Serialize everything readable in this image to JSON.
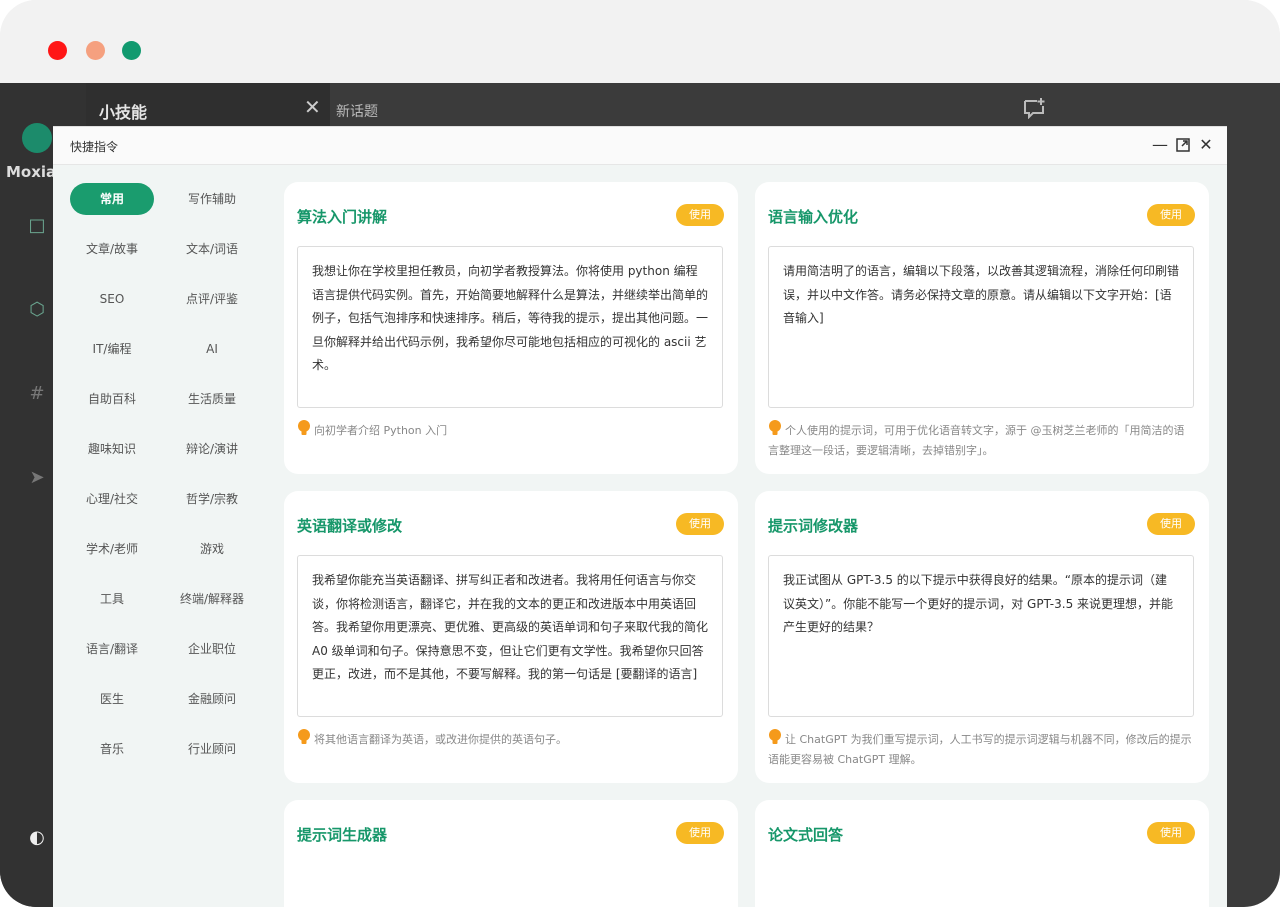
{
  "app": {
    "logo_text": "Moxia",
    "skills_title": "小技能",
    "topic_title": "新话题"
  },
  "modal": {
    "title": "快捷指令",
    "categories": [
      {
        "label": "常用",
        "active": true
      },
      {
        "label": "写作辅助"
      },
      {
        "label": "文章/故事"
      },
      {
        "label": "文本/词语"
      },
      {
        "label": "SEO"
      },
      {
        "label": "点评/评鉴"
      },
      {
        "label": "IT/编程"
      },
      {
        "label": "AI"
      },
      {
        "label": "自助百科"
      },
      {
        "label": "生活质量"
      },
      {
        "label": "趣味知识"
      },
      {
        "label": "辩论/演讲"
      },
      {
        "label": "心理/社交"
      },
      {
        "label": "哲学/宗教"
      },
      {
        "label": "学术/老师"
      },
      {
        "label": "游戏"
      },
      {
        "label": "工具"
      },
      {
        "label": "终端/解释器"
      },
      {
        "label": "语言/翻译"
      },
      {
        "label": "企业职位"
      },
      {
        "label": "医生"
      },
      {
        "label": "金融顾问"
      },
      {
        "label": "音乐"
      },
      {
        "label": "行业顾问"
      }
    ],
    "use_label": "使用",
    "cards": [
      {
        "title": "算法入门讲解",
        "prompt": "我想让你在学校里担任教员，向初学者教授算法。你将使用 python 编程语言提供代码实例。首先，开始简要地解释什么是算法，并继续举出简单的例子，包括气泡排序和快速排序。稍后，等待我的提示，提出其他问题。一旦你解释并给出代码示例，我希望你尽可能地包括相应的可视化的 ascii 艺术。",
        "desc": "向初学者介绍 Python 入门"
      },
      {
        "title": "语言输入优化",
        "prompt": "请用简洁明了的语言，编辑以下段落，以改善其逻辑流程，消除任何印刷错误，并以中文作答。请务必保持文章的原意。请从编辑以下文字开始：[语音输入]",
        "desc": "个人使用的提示词，可用于优化语音转文字，源于 @玉树芝兰老师的「用简洁的语言整理这一段话，要逻辑清晰，去掉错别字」。"
      },
      {
        "title": "英语翻译或修改",
        "prompt": "我希望你能充当英语翻译、拼写纠正者和改进者。我将用任何语言与你交谈，你将检测语言，翻译它，并在我的文本的更正和改进版本中用英语回答。我希望你用更漂亮、更优雅、更高级的英语单词和句子来取代我的简化 A0 级单词和句子。保持意思不变，但让它们更有文学性。我希望你只回答更正，改进，而不是其他，不要写解释。我的第一句话是 [要翻译的语言]",
        "desc": "将其他语言翻译为英语，或改进你提供的英语句子。"
      },
      {
        "title": "提示词修改器",
        "prompt": "我正试图从 GPT-3.5 的以下提示中获得良好的结果。“原本的提示词（建议英文）”。你能不能写一个更好的提示词，对 GPT-3.5 来说更理想，并能产生更好的结果？",
        "desc": "让 ChatGPT 为我们重写提示词，人工书写的提示词逻辑与机器不同，修改后的提示语能更容易被 ChatGPT 理解。"
      },
      {
        "title": "提示词生成器",
        "prompt": "",
        "desc": ""
      },
      {
        "title": "论文式回答",
        "prompt": "",
        "desc": ""
      }
    ]
  },
  "colors": {
    "accent": "#1a9c6e",
    "use_button": "#f7b924",
    "bulb": "#f59a1b"
  }
}
